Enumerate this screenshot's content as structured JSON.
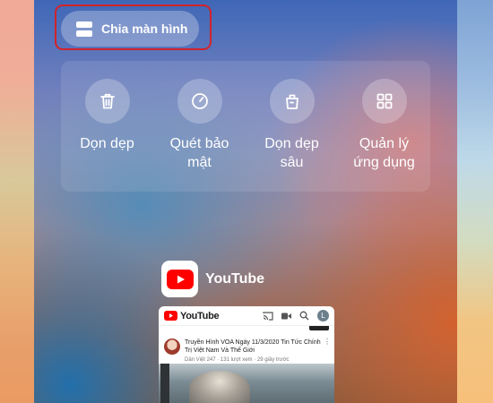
{
  "split_screen": {
    "label": "Chia màn hình",
    "icon": "split-screen-icon"
  },
  "tools": [
    {
      "id": "clean",
      "label": "Dọn dẹp",
      "icon": "trash-icon"
    },
    {
      "id": "security",
      "label": "Quét bảo\nmật",
      "icon": "security-scan-icon"
    },
    {
      "id": "deep-clean",
      "label": "Dọn dẹp\nsâu",
      "icon": "deep-clean-icon"
    },
    {
      "id": "apps",
      "label": "Quản lý\nứng dụng",
      "icon": "apps-grid-icon"
    }
  ],
  "recent_app": {
    "name": "YouTube",
    "brand_text": "YouTube",
    "avatar_letter": "L",
    "video": {
      "title": "Truyền Hình VOA Ngày 11/3/2020 Tin Tức Chính Trị Việt Nam Và Thế Giới",
      "meta": "Dân Việt 247 · 131 lượt xem · 29 giây trước",
      "menu_glyph": "⋮"
    }
  },
  "colors": {
    "highlight_border": "#d2232a",
    "youtube_red": "#ff0000"
  }
}
